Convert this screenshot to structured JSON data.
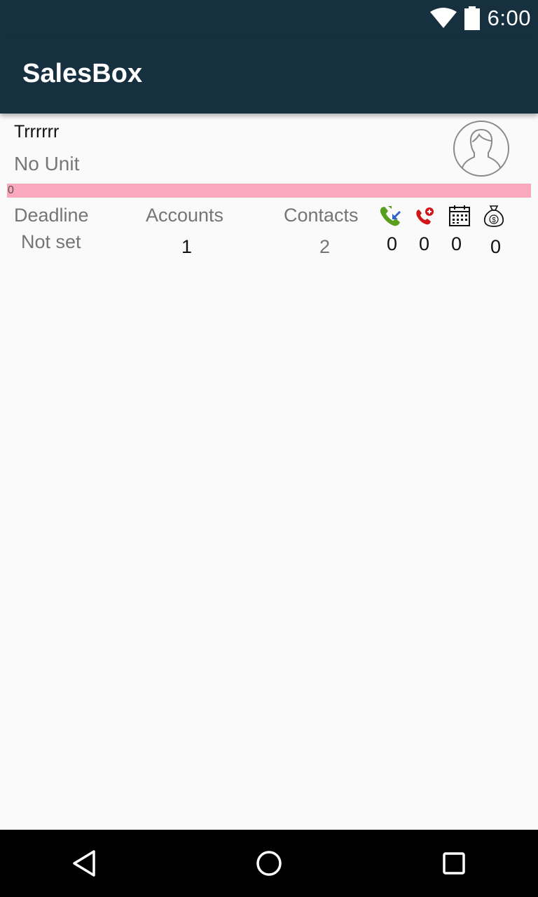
{
  "status_bar": {
    "time": "6:00",
    "icons": [
      "wifi-icon",
      "battery-icon"
    ]
  },
  "app_bar": {
    "title": "SalesBox",
    "background": "#163040"
  },
  "profile": {
    "name": "Trrrrrr",
    "unit": "No Unit",
    "avatar_icon": "person-silhouette-icon"
  },
  "progress": {
    "label": "0",
    "value": 0,
    "color": "#f9a9bb"
  },
  "stats": {
    "deadline": {
      "label": "Deadline",
      "value": "Not set"
    },
    "accounts": {
      "label": "Accounts",
      "value": "1"
    },
    "contacts": {
      "label": "Contacts",
      "value": "2"
    }
  },
  "activity_counts": [
    {
      "icon": "incoming-call-icon",
      "value": "0"
    },
    {
      "icon": "missed-call-icon",
      "value": "0"
    },
    {
      "icon": "calendar-icon",
      "value": "0"
    },
    {
      "icon": "money-bag-icon",
      "value": "0"
    }
  ],
  "nav_bar": {
    "buttons": [
      "back-icon",
      "home-icon",
      "recents-icon"
    ]
  }
}
